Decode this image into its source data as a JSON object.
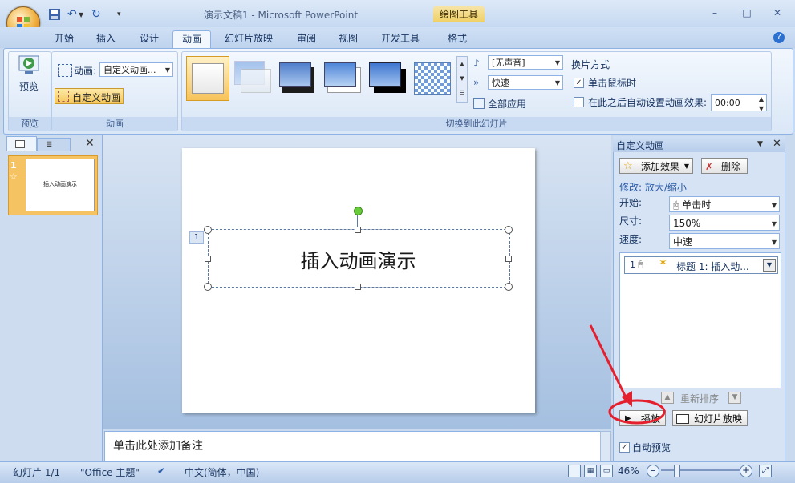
{
  "window": {
    "title": "演示文稿1 - Microsoft PowerPoint",
    "context_tab_header": "绘图工具",
    "minimize": "–",
    "restore": "□",
    "close": "✕",
    "help": "?"
  },
  "tabs": [
    "开始",
    "插入",
    "设计",
    "动画",
    "幻灯片放映",
    "审阅",
    "视图",
    "开发工具",
    "格式"
  ],
  "active_tab": "动画",
  "ribbon": {
    "preview_group": {
      "button": "预览",
      "label": "预览"
    },
    "animation_group": {
      "animate_label": "动画:",
      "animate_value": "自定义动画...",
      "custom_animation_button": "自定义动画",
      "label": "动画"
    },
    "transition_group": {
      "label": "切换到此幻灯片",
      "sound_value": "[无声音]",
      "speed_value": "快速",
      "apply_all": "全部应用"
    },
    "advance_group": {
      "title": "换片方式",
      "on_click_label": "单击鼠标时",
      "on_click_checked": true,
      "auto_label": "在此之后自动设置动画效果:",
      "auto_checked": false,
      "auto_time": "00:00"
    }
  },
  "slides_pane": {
    "slide_number": "1",
    "thumb_text": "插入动画演示"
  },
  "slide": {
    "title_text": "插入动画演示",
    "anim_tag": "1"
  },
  "notes_placeholder": "单击此处添加备注",
  "task_pane": {
    "title": "自定义动画",
    "add_effect": "添加效果",
    "remove": "删除",
    "modify_label": "修改: 放大/缩小",
    "start_label": "开始:",
    "start_value": "单击时",
    "size_label": "尺寸:",
    "size_value": "150%",
    "speed_label": "速度:",
    "speed_value": "中速",
    "effect_list": [
      {
        "order": "1",
        "text": "标题 1: 插入动..."
      }
    ],
    "reorder_label": "重新排序",
    "play_button": "播放",
    "slideshow_button": "幻灯片放映",
    "autopreview_label": "自动预览",
    "autopreview_checked": true
  },
  "statusbar": {
    "slide_info": "幻灯片 1/1",
    "theme": "\"Office 主题\"",
    "language": "中文(简体，中国)",
    "zoom": "46%"
  },
  "colors": {
    "ribbon_bg": "#dae7f7",
    "accent_orange": "#f5c75a",
    "annotation_red": "#e5202e"
  }
}
